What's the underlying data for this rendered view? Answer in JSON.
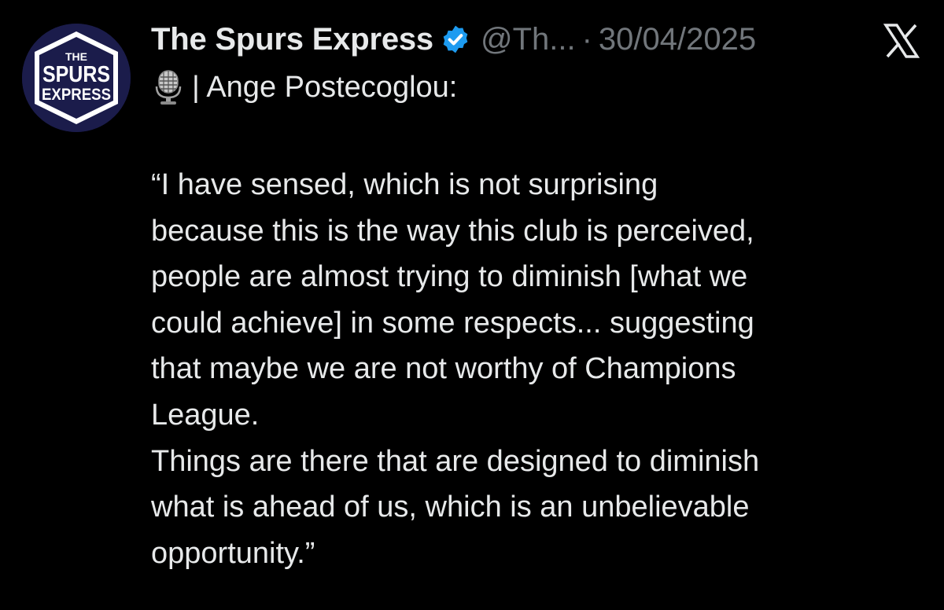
{
  "tweet": {
    "author": {
      "avatar": {
        "line1": "THE",
        "line2": "SPURS",
        "line3": "EXPRESS",
        "bg_color": "#1b1c4b",
        "ring_color": "#ffffff"
      },
      "display_name": "The Spurs Express",
      "verified_icon": "verified-badge-icon",
      "verified_color": "#1d9bf0",
      "handle": "@Th...",
      "separator": "·",
      "date": "30/04/2025"
    },
    "platform_icon": "x-logo-icon",
    "subline": {
      "icon": "microphone-icon",
      "text": "| Ange Postecoglou:"
    },
    "body_lines": [
      "“I have sensed, which is not surprising",
      "because this is the way this club is perceived,",
      "people are almost trying to diminish [what we",
      "could achieve] in some respects... suggesting",
      "that maybe we are not worthy of Champions",
      "League.",
      "Things are there that are designed to diminish",
      "what is ahead of us, which is an unbelievable",
      "opportunity.”"
    ],
    "colors": {
      "background": "#000000",
      "primary_text": "#e7e9ea",
      "secondary_text": "#71767b"
    }
  }
}
